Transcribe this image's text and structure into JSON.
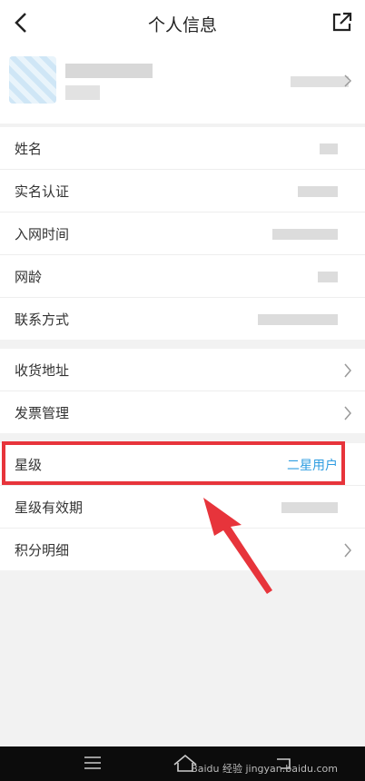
{
  "header": {
    "title": "个人信息"
  },
  "profile": {},
  "info_section": [
    {
      "label": "姓名"
    },
    {
      "label": "实名认证"
    },
    {
      "label": "入网时间"
    },
    {
      "label": "网龄"
    },
    {
      "label": "联系方式"
    }
  ],
  "address_section": [
    {
      "label": "收货地址"
    },
    {
      "label": "发票管理"
    }
  ],
  "star_section": [
    {
      "label": "星级",
      "value": "二星用户"
    },
    {
      "label": "星级有效期"
    },
    {
      "label": "积分明细"
    }
  ],
  "watermark": "Baidu 经验 jingyan.baidu.com",
  "colors": {
    "highlight": "#e7343b",
    "link": "#2f9de1"
  }
}
